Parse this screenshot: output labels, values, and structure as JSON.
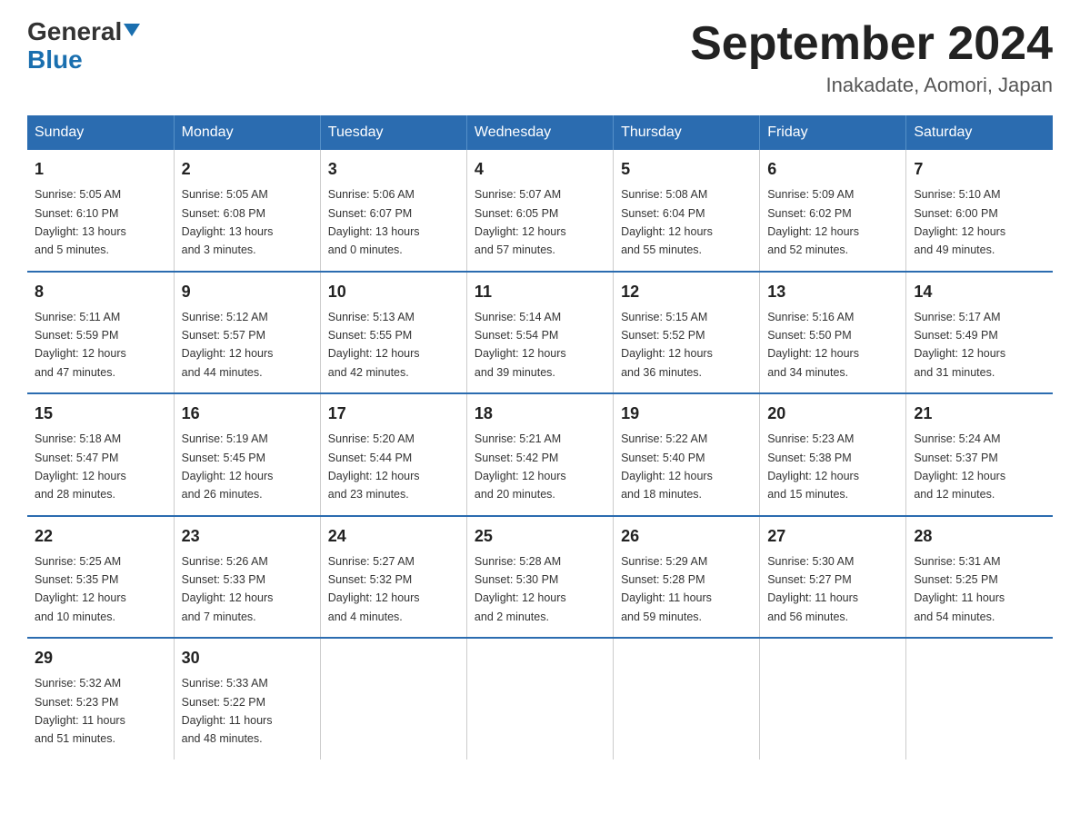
{
  "header": {
    "logo_general": "General",
    "logo_blue": "Blue",
    "month_year": "September 2024",
    "location": "Inakadate, Aomori, Japan"
  },
  "days_of_week": [
    "Sunday",
    "Monday",
    "Tuesday",
    "Wednesday",
    "Thursday",
    "Friday",
    "Saturday"
  ],
  "weeks": [
    [
      {
        "day": "1",
        "sunrise": "5:05 AM",
        "sunset": "6:10 PM",
        "daylight": "13 hours and 5 minutes."
      },
      {
        "day": "2",
        "sunrise": "5:05 AM",
        "sunset": "6:08 PM",
        "daylight": "13 hours and 3 minutes."
      },
      {
        "day": "3",
        "sunrise": "5:06 AM",
        "sunset": "6:07 PM",
        "daylight": "13 hours and 0 minutes."
      },
      {
        "day": "4",
        "sunrise": "5:07 AM",
        "sunset": "6:05 PM",
        "daylight": "12 hours and 57 minutes."
      },
      {
        "day": "5",
        "sunrise": "5:08 AM",
        "sunset": "6:04 PM",
        "daylight": "12 hours and 55 minutes."
      },
      {
        "day": "6",
        "sunrise": "5:09 AM",
        "sunset": "6:02 PM",
        "daylight": "12 hours and 52 minutes."
      },
      {
        "day": "7",
        "sunrise": "5:10 AM",
        "sunset": "6:00 PM",
        "daylight": "12 hours and 49 minutes."
      }
    ],
    [
      {
        "day": "8",
        "sunrise": "5:11 AM",
        "sunset": "5:59 PM",
        "daylight": "12 hours and 47 minutes."
      },
      {
        "day": "9",
        "sunrise": "5:12 AM",
        "sunset": "5:57 PM",
        "daylight": "12 hours and 44 minutes."
      },
      {
        "day": "10",
        "sunrise": "5:13 AM",
        "sunset": "5:55 PM",
        "daylight": "12 hours and 42 minutes."
      },
      {
        "day": "11",
        "sunrise": "5:14 AM",
        "sunset": "5:54 PM",
        "daylight": "12 hours and 39 minutes."
      },
      {
        "day": "12",
        "sunrise": "5:15 AM",
        "sunset": "5:52 PM",
        "daylight": "12 hours and 36 minutes."
      },
      {
        "day": "13",
        "sunrise": "5:16 AM",
        "sunset": "5:50 PM",
        "daylight": "12 hours and 34 minutes."
      },
      {
        "day": "14",
        "sunrise": "5:17 AM",
        "sunset": "5:49 PM",
        "daylight": "12 hours and 31 minutes."
      }
    ],
    [
      {
        "day": "15",
        "sunrise": "5:18 AM",
        "sunset": "5:47 PM",
        "daylight": "12 hours and 28 minutes."
      },
      {
        "day": "16",
        "sunrise": "5:19 AM",
        "sunset": "5:45 PM",
        "daylight": "12 hours and 26 minutes."
      },
      {
        "day": "17",
        "sunrise": "5:20 AM",
        "sunset": "5:44 PM",
        "daylight": "12 hours and 23 minutes."
      },
      {
        "day": "18",
        "sunrise": "5:21 AM",
        "sunset": "5:42 PM",
        "daylight": "12 hours and 20 minutes."
      },
      {
        "day": "19",
        "sunrise": "5:22 AM",
        "sunset": "5:40 PM",
        "daylight": "12 hours and 18 minutes."
      },
      {
        "day": "20",
        "sunrise": "5:23 AM",
        "sunset": "5:38 PM",
        "daylight": "12 hours and 15 minutes."
      },
      {
        "day": "21",
        "sunrise": "5:24 AM",
        "sunset": "5:37 PM",
        "daylight": "12 hours and 12 minutes."
      }
    ],
    [
      {
        "day": "22",
        "sunrise": "5:25 AM",
        "sunset": "5:35 PM",
        "daylight": "12 hours and 10 minutes."
      },
      {
        "day": "23",
        "sunrise": "5:26 AM",
        "sunset": "5:33 PM",
        "daylight": "12 hours and 7 minutes."
      },
      {
        "day": "24",
        "sunrise": "5:27 AM",
        "sunset": "5:32 PM",
        "daylight": "12 hours and 4 minutes."
      },
      {
        "day": "25",
        "sunrise": "5:28 AM",
        "sunset": "5:30 PM",
        "daylight": "12 hours and 2 minutes."
      },
      {
        "day": "26",
        "sunrise": "5:29 AM",
        "sunset": "5:28 PM",
        "daylight": "11 hours and 59 minutes."
      },
      {
        "day": "27",
        "sunrise": "5:30 AM",
        "sunset": "5:27 PM",
        "daylight": "11 hours and 56 minutes."
      },
      {
        "day": "28",
        "sunrise": "5:31 AM",
        "sunset": "5:25 PM",
        "daylight": "11 hours and 54 minutes."
      }
    ],
    [
      {
        "day": "29",
        "sunrise": "5:32 AM",
        "sunset": "5:23 PM",
        "daylight": "11 hours and 51 minutes."
      },
      {
        "day": "30",
        "sunrise": "5:33 AM",
        "sunset": "5:22 PM",
        "daylight": "11 hours and 48 minutes."
      },
      null,
      null,
      null,
      null,
      null
    ]
  ],
  "labels": {
    "sunrise": "Sunrise:",
    "sunset": "Sunset:",
    "daylight": "Daylight:"
  }
}
